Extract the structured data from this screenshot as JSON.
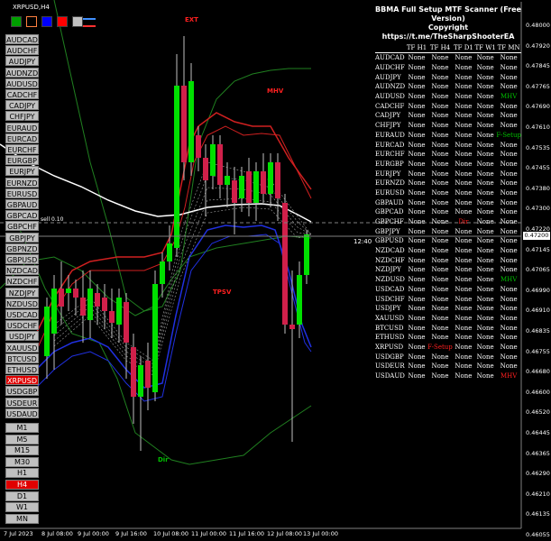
{
  "window": {
    "title": "XRPUSD,H4"
  },
  "toolbox_colors": [
    "#00a000",
    "#ff8040",
    "#0000ff",
    "#ff0000",
    "#c0c0c0"
  ],
  "symbols": [
    "AUDCAD",
    "AUDCHF",
    "AUDJPY",
    "AUDNZD",
    "AUDUSD",
    "CADCHF",
    "CADJPY",
    "CHFJPY",
    "EURAUD",
    "EURCAD",
    "EURCHF",
    "EURGBP",
    "EURJPY",
    "EURNZD",
    "EURUSD",
    "GBPAUD",
    "GBPCAD",
    "GBPCHF",
    "GBPJPY",
    "GBPNZD",
    "GBPUSD",
    "NZDCAD",
    "NZDCHF",
    "NZDJPY",
    "NZDUSD",
    "USDCAD",
    "USDCHF",
    "USDJPY",
    "XAUUSD",
    "BTCUSD",
    "ETHUSD",
    "XRPUSD",
    "USDGBP",
    "USDEUR",
    "USDAUD"
  ],
  "active_symbol": "XRPUSD",
  "timeframes": [
    "M1",
    "M5",
    "M15",
    "M30",
    "H1",
    "H4",
    "D1",
    "W1",
    "MN"
  ],
  "active_timeframe": "H4",
  "scanner": {
    "title": "BBMA Full Setup MTF Scanner (Free Version)",
    "copyright": "Copyright https://t.me/TheSharpShooterEA",
    "headers": [
      "",
      "TF H1",
      "TF H4",
      "TF D1",
      "TF W1",
      "TF MN"
    ],
    "rows": [
      [
        "AUDCAD",
        "None",
        "None",
        "None",
        "None",
        "None"
      ],
      [
        "AUDCHF",
        "None",
        "None",
        "None",
        "None",
        "None"
      ],
      [
        "AUDJPY",
        "None",
        "None",
        "None",
        "None",
        "None"
      ],
      [
        "AUDNZD",
        "None",
        "None",
        "None",
        "None",
        "None"
      ],
      [
        "AUDUSD",
        "None",
        "None",
        "None",
        "None",
        "MHV"
      ],
      [
        "CADCHF",
        "None",
        "None",
        "None",
        "None",
        "None"
      ],
      [
        "CADJPY",
        "None",
        "None",
        "None",
        "None",
        "None"
      ],
      [
        "CHFJPY",
        "None",
        "None",
        "None",
        "None",
        "None"
      ],
      [
        "EURAUD",
        "None",
        "None",
        "None",
        "None",
        "F-Setup"
      ],
      [
        "EURCAD",
        "None",
        "None",
        "None",
        "None",
        "None"
      ],
      [
        "EURCHF",
        "None",
        "None",
        "None",
        "None",
        "None"
      ],
      [
        "EURGBP",
        "None",
        "None",
        "None",
        "None",
        "None"
      ],
      [
        "EURJPY",
        "None",
        "None",
        "None",
        "None",
        "None"
      ],
      [
        "EURNZD",
        "None",
        "None",
        "None",
        "None",
        "None"
      ],
      [
        "EURUSD",
        "None",
        "None",
        "None",
        "None",
        "None"
      ],
      [
        "GBPAUD",
        "None",
        "None",
        "None",
        "None",
        "None"
      ],
      [
        "GBPCAD",
        "None",
        "None",
        "None",
        "None",
        "None"
      ],
      [
        "GBPCHF",
        "None",
        "None",
        "Dir",
        "None",
        "None"
      ],
      [
        "GBPJPY",
        "None",
        "None",
        "None",
        "None",
        "None"
      ],
      [
        "GBPUSD",
        "None",
        "None",
        "None",
        "None",
        "None"
      ],
      [
        "NZDCAD",
        "None",
        "None",
        "None",
        "None",
        "None"
      ],
      [
        "NZDCHF",
        "None",
        "None",
        "None",
        "None",
        "None"
      ],
      [
        "NZDJPY",
        "None",
        "None",
        "None",
        "None",
        "None"
      ],
      [
        "NZDUSD",
        "None",
        "None",
        "None",
        "None",
        "MHV"
      ],
      [
        "USDCAD",
        "None",
        "None",
        "None",
        "None",
        "None"
      ],
      [
        "USDCHF",
        "None",
        "None",
        "None",
        "None",
        "None"
      ],
      [
        "USDJPY",
        "None",
        "None",
        "None",
        "None",
        "None"
      ],
      [
        "XAUUSD",
        "None",
        "None",
        "None",
        "None",
        "None"
      ],
      [
        "BTCUSD",
        "None",
        "None",
        "None",
        "None",
        "None"
      ],
      [
        "ETHUSD",
        "None",
        "None",
        "None",
        "None",
        "None"
      ],
      [
        "XRPUSD",
        "None",
        "F-Setup",
        "None",
        "None",
        "None"
      ],
      [
        "USDGBP",
        "None",
        "None",
        "None",
        "None",
        "None"
      ],
      [
        "USDEUR",
        "None",
        "None",
        "None",
        "None",
        "None"
      ],
      [
        "USDAUD",
        "None",
        "None",
        "None",
        "None",
        "MHV"
      ]
    ],
    "highlight_colors": {
      "MHV": "#00c000",
      "F-Setup": "#00c000",
      "Dir": "#ff2020",
      "XRPUSD.F-Setup": "#ff2020",
      "USDAUD.MHV": "#ff2020"
    }
  },
  "price_axis": [
    "0.48000",
    "0.47920",
    "0.47845",
    "0.47765",
    "0.47690",
    "0.47610",
    "0.47535",
    "0.47455",
    "0.47380",
    "0.47300",
    "0.47220",
    "0.47145",
    "0.47065",
    "0.46990",
    "0.46910",
    "0.46835",
    "0.46755",
    "0.46680",
    "0.46600",
    "0.46520",
    "0.46445",
    "0.46365",
    "0.46290",
    "0.46210",
    "0.46135",
    "0.46055"
  ],
  "current_price": "0.47200",
  "time_axis": [
    "7 Jul 2023",
    "8 Jul 08:00",
    "9 Jul 00:00",
    "9 Jul 16:00",
    "10 Jul 08:00",
    "11 Jul 00:00",
    "11 Jul 16:00",
    "12 Jul 08:00",
    "13 Jul 00:00"
  ],
  "annotations": {
    "ext": "EXT",
    "mhv": "MHV",
    "tpsv": "TPSV",
    "dir": "Dir",
    "hline_label": "sell 0.10",
    "time_label": "12:40"
  },
  "colors": {
    "bull": "#00e000",
    "bear": "#d0204a",
    "upper_band": "#d02020",
    "lower_band": "#2030e0",
    "ma": "#ffffff",
    "outer_band": "#208020"
  }
}
